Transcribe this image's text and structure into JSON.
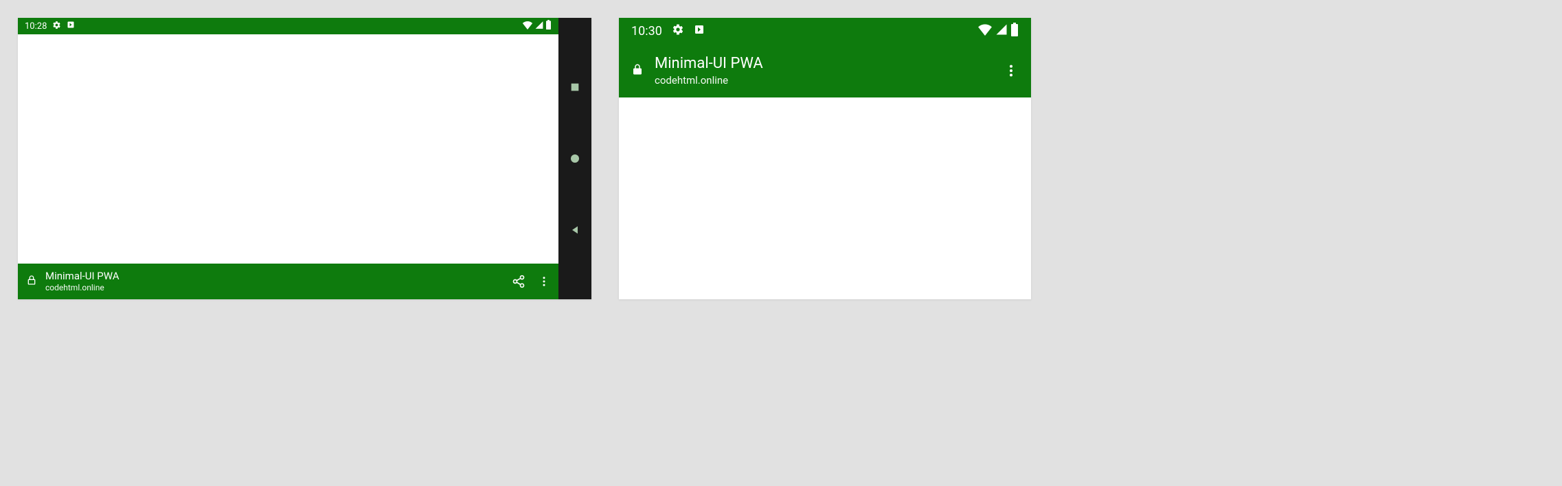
{
  "colors": {
    "theme": "#0e7b0d",
    "nav_rail": "#1a1a1a",
    "nav_icon": "#a8c7a8",
    "bg": "#e1e1e1"
  },
  "device1": {
    "status": {
      "time": "10:28"
    },
    "app": {
      "title": "Minimal-UI PWA",
      "subtitle": "codehtml.online"
    }
  },
  "device2": {
    "status": {
      "time": "10:30"
    },
    "app": {
      "title": "Minimal-UI PWA",
      "subtitle": "codehtml.online"
    }
  }
}
